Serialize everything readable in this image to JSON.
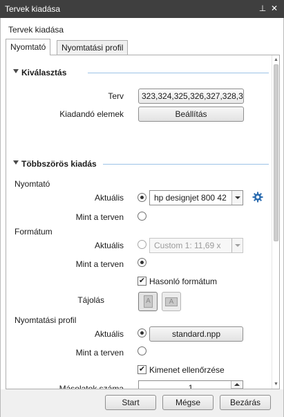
{
  "window": {
    "title": "Tervek kiadása",
    "pin_glyph": "⊥",
    "close_glyph": "✕"
  },
  "dialog": {
    "subtitle": "Tervek kiadása"
  },
  "tabs": [
    {
      "label": "Nyomtató",
      "active": true
    },
    {
      "label": "Nyomtatási profil",
      "active": false
    }
  ],
  "selection": {
    "title": "Kiválasztás",
    "plan_label": "Terv",
    "plan_value": "323,324,325,326,327,328,3...",
    "elements_label": "Kiadandó elemek",
    "elements_button": "Beállítás"
  },
  "multi": {
    "title": "Többszörös kiadás",
    "printer_group": "Nyomtató",
    "current_label": "Aktuális",
    "printer_value": "hp designjet 800 42",
    "as_in_plan_label": "Mint a terven",
    "format_group": "Formátum",
    "format_value": "Custom 1:  11,69  x",
    "similar_format_label": "Hasonló formátum",
    "orientation_label": "Tájolás",
    "orientation_glyph": "A",
    "profile_group": "Nyomtatási profil",
    "profile_value": "standard.npp",
    "output_check_label": "Kimenet ellenőrzése",
    "copies_label": "Másolatok száma",
    "copies_value": "1",
    "check_glyph": "✔"
  },
  "footer": {
    "start": "Start",
    "cancel": "Mégse",
    "close": "Bezárás"
  },
  "colors": {
    "titlebar": "#3f3f3f",
    "section_line": "#9cc3e6",
    "gear": "#2b6cb0"
  },
  "icons": {
    "gear": "gear-icon",
    "pin": "pin-icon",
    "close": "close-icon"
  }
}
